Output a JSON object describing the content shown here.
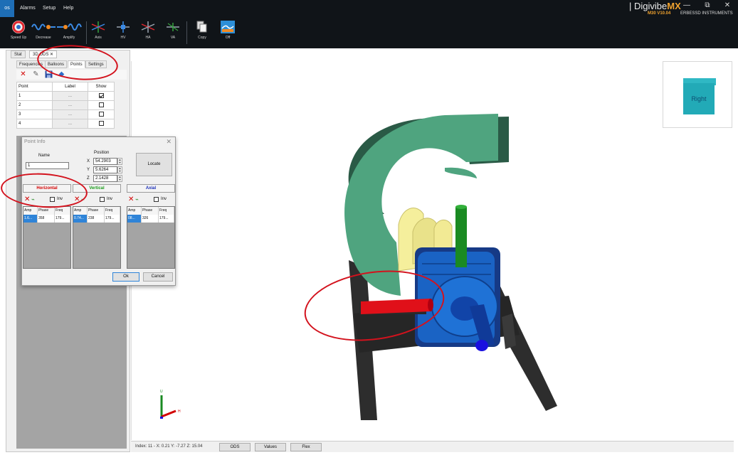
{
  "menubar": {
    "os_label": "os",
    "items": [
      "Alarms",
      "Setup",
      "Help"
    ],
    "brand": {
      "name_prefix": "Digivibe",
      "name_suffix": "MX",
      "version": "M30 V10.04",
      "company": "ERBESSD INSTRUMENTS"
    },
    "window_buttons": [
      "—",
      "⧉",
      "✕"
    ]
  },
  "ribbon": {
    "tools": [
      {
        "label": "Speed Up",
        "icon": "speed-up-icon"
      },
      {
        "label": "Decrease",
        "icon": "decrease-icon"
      },
      {
        "label": "Amplify",
        "icon": "amplify-icon"
      },
      {
        "label": "Axis",
        "icon": "axis-icon"
      },
      {
        "label": "HV",
        "icon": "hv-icon"
      },
      {
        "label": "HA",
        "icon": "ha-icon"
      },
      {
        "label": "VA",
        "icon": "va-icon"
      },
      {
        "label": "Copy",
        "icon": "copy-icon"
      },
      {
        "label": "Off",
        "icon": "off-icon"
      }
    ]
  },
  "left_panel": {
    "doc_tabs": [
      "Stat",
      "3D ODS"
    ],
    "sub_tabs": [
      "Frequencies",
      "Balloons",
      "Points",
      "Settings"
    ],
    "active_sub_tab": "Points",
    "points_table": {
      "headers": [
        "Point",
        "Label",
        "Show"
      ],
      "rows": [
        {
          "point": "1",
          "label": "...",
          "show": true
        },
        {
          "point": "2",
          "label": "...",
          "show": false
        },
        {
          "point": "3",
          "label": "...",
          "show": false
        },
        {
          "point": "4",
          "label": "...",
          "show": false
        }
      ]
    }
  },
  "point_info": {
    "title": "Point Info",
    "close": "✕",
    "name_label": "Name",
    "name_value": "1",
    "position_label": "Position",
    "x_label": "X",
    "x_value": "54.2903",
    "y_label": "Y",
    "y_value": "5.6264",
    "z_label": "Z",
    "z_value": "2.1428",
    "locate_label": "Locate",
    "inv_label": "Inv",
    "axes": [
      {
        "name": "Horizontal",
        "color": "#d40000",
        "headers": [
          "Amp",
          "Phase",
          "Freq"
        ],
        "values": [
          "1.6...",
          "358",
          "179..."
        ]
      },
      {
        "name": "Vertical",
        "color": "#1a9a1a",
        "headers": [
          "Amp",
          "Phase",
          "Freq"
        ],
        "values": [
          "0.74...",
          "238",
          "179..."
        ]
      },
      {
        "name": "Axial",
        "color": "#1b2fb8",
        "headers": [
          "Amp",
          "Phase",
          "Freq"
        ],
        "values": [
          "08...",
          "326",
          "179..."
        ]
      }
    ],
    "ok_label": "Ok",
    "cancel_label": "Cancel"
  },
  "viewport": {
    "view_cube_label": "Right",
    "axis_labels": {
      "up": "U",
      "right": "H"
    }
  },
  "statusbar": {
    "text": "Index: 11 - X: 0.21 Y: -7.27 Z: 15.04",
    "buttons": [
      "ODS",
      "Values",
      "Flex"
    ]
  },
  "colors": {
    "fan_housing": "#4fa47f",
    "motor": "#1a63c4",
    "horizontal_arrow": "#e01019",
    "vertical_arrow": "#1a8a22",
    "axial_arrow": "#1a10e0",
    "annotation": "#d3121d",
    "base": "#2d2d2d",
    "pillow_block": "#f5ef9c"
  }
}
